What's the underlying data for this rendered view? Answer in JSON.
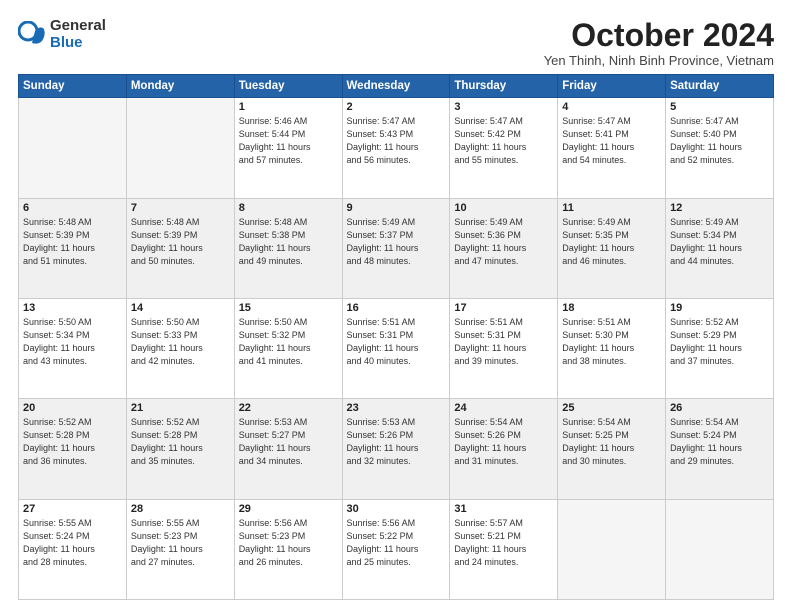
{
  "logo": {
    "general": "General",
    "blue": "Blue"
  },
  "title": "October 2024",
  "subtitle": "Yen Thinh, Ninh Binh Province, Vietnam",
  "headers": [
    "Sunday",
    "Monday",
    "Tuesday",
    "Wednesday",
    "Thursday",
    "Friday",
    "Saturday"
  ],
  "weeks": [
    [
      {
        "day": "",
        "info": ""
      },
      {
        "day": "",
        "info": ""
      },
      {
        "day": "1",
        "info": "Sunrise: 5:46 AM\nSunset: 5:44 PM\nDaylight: 11 hours\nand 57 minutes."
      },
      {
        "day": "2",
        "info": "Sunrise: 5:47 AM\nSunset: 5:43 PM\nDaylight: 11 hours\nand 56 minutes."
      },
      {
        "day": "3",
        "info": "Sunrise: 5:47 AM\nSunset: 5:42 PM\nDaylight: 11 hours\nand 55 minutes."
      },
      {
        "day": "4",
        "info": "Sunrise: 5:47 AM\nSunset: 5:41 PM\nDaylight: 11 hours\nand 54 minutes."
      },
      {
        "day": "5",
        "info": "Sunrise: 5:47 AM\nSunset: 5:40 PM\nDaylight: 11 hours\nand 52 minutes."
      }
    ],
    [
      {
        "day": "6",
        "info": "Sunrise: 5:48 AM\nSunset: 5:39 PM\nDaylight: 11 hours\nand 51 minutes."
      },
      {
        "day": "7",
        "info": "Sunrise: 5:48 AM\nSunset: 5:39 PM\nDaylight: 11 hours\nand 50 minutes."
      },
      {
        "day": "8",
        "info": "Sunrise: 5:48 AM\nSunset: 5:38 PM\nDaylight: 11 hours\nand 49 minutes."
      },
      {
        "day": "9",
        "info": "Sunrise: 5:49 AM\nSunset: 5:37 PM\nDaylight: 11 hours\nand 48 minutes."
      },
      {
        "day": "10",
        "info": "Sunrise: 5:49 AM\nSunset: 5:36 PM\nDaylight: 11 hours\nand 47 minutes."
      },
      {
        "day": "11",
        "info": "Sunrise: 5:49 AM\nSunset: 5:35 PM\nDaylight: 11 hours\nand 46 minutes."
      },
      {
        "day": "12",
        "info": "Sunrise: 5:49 AM\nSunset: 5:34 PM\nDaylight: 11 hours\nand 44 minutes."
      }
    ],
    [
      {
        "day": "13",
        "info": "Sunrise: 5:50 AM\nSunset: 5:34 PM\nDaylight: 11 hours\nand 43 minutes."
      },
      {
        "day": "14",
        "info": "Sunrise: 5:50 AM\nSunset: 5:33 PM\nDaylight: 11 hours\nand 42 minutes."
      },
      {
        "day": "15",
        "info": "Sunrise: 5:50 AM\nSunset: 5:32 PM\nDaylight: 11 hours\nand 41 minutes."
      },
      {
        "day": "16",
        "info": "Sunrise: 5:51 AM\nSunset: 5:31 PM\nDaylight: 11 hours\nand 40 minutes."
      },
      {
        "day": "17",
        "info": "Sunrise: 5:51 AM\nSunset: 5:31 PM\nDaylight: 11 hours\nand 39 minutes."
      },
      {
        "day": "18",
        "info": "Sunrise: 5:51 AM\nSunset: 5:30 PM\nDaylight: 11 hours\nand 38 minutes."
      },
      {
        "day": "19",
        "info": "Sunrise: 5:52 AM\nSunset: 5:29 PM\nDaylight: 11 hours\nand 37 minutes."
      }
    ],
    [
      {
        "day": "20",
        "info": "Sunrise: 5:52 AM\nSunset: 5:28 PM\nDaylight: 11 hours\nand 36 minutes."
      },
      {
        "day": "21",
        "info": "Sunrise: 5:52 AM\nSunset: 5:28 PM\nDaylight: 11 hours\nand 35 minutes."
      },
      {
        "day": "22",
        "info": "Sunrise: 5:53 AM\nSunset: 5:27 PM\nDaylight: 11 hours\nand 34 minutes."
      },
      {
        "day": "23",
        "info": "Sunrise: 5:53 AM\nSunset: 5:26 PM\nDaylight: 11 hours\nand 32 minutes."
      },
      {
        "day": "24",
        "info": "Sunrise: 5:54 AM\nSunset: 5:26 PM\nDaylight: 11 hours\nand 31 minutes."
      },
      {
        "day": "25",
        "info": "Sunrise: 5:54 AM\nSunset: 5:25 PM\nDaylight: 11 hours\nand 30 minutes."
      },
      {
        "day": "26",
        "info": "Sunrise: 5:54 AM\nSunset: 5:24 PM\nDaylight: 11 hours\nand 29 minutes."
      }
    ],
    [
      {
        "day": "27",
        "info": "Sunrise: 5:55 AM\nSunset: 5:24 PM\nDaylight: 11 hours\nand 28 minutes."
      },
      {
        "day": "28",
        "info": "Sunrise: 5:55 AM\nSunset: 5:23 PM\nDaylight: 11 hours\nand 27 minutes."
      },
      {
        "day": "29",
        "info": "Sunrise: 5:56 AM\nSunset: 5:23 PM\nDaylight: 11 hours\nand 26 minutes."
      },
      {
        "day": "30",
        "info": "Sunrise: 5:56 AM\nSunset: 5:22 PM\nDaylight: 11 hours\nand 25 minutes."
      },
      {
        "day": "31",
        "info": "Sunrise: 5:57 AM\nSunset: 5:21 PM\nDaylight: 11 hours\nand 24 minutes."
      },
      {
        "day": "",
        "info": ""
      },
      {
        "day": "",
        "info": ""
      }
    ]
  ]
}
